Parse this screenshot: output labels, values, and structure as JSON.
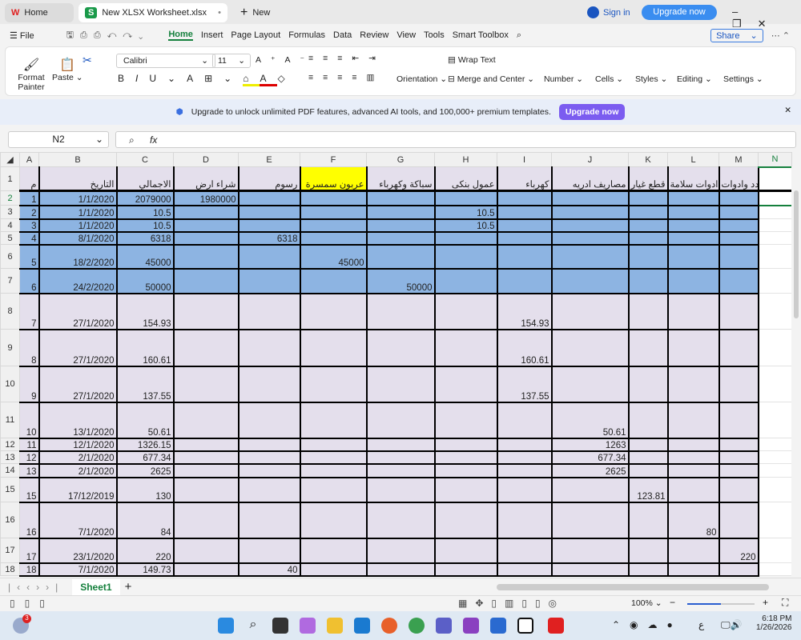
{
  "tabs": {
    "home": "Home",
    "file": "New XLSX Worksheet.xlsx",
    "new": "New"
  },
  "window": {
    "signin": "Sign in",
    "upgrade": "Upgrade now"
  },
  "menu": {
    "file": "File",
    "items": [
      "Home",
      "Insert",
      "Page Layout",
      "Formulas",
      "Data",
      "Review",
      "View",
      "Tools",
      "Smart Toolbox"
    ],
    "share": "Share"
  },
  "ribbon": {
    "format_painter": "Format Painter",
    "paste": "Paste",
    "font": "Calibri",
    "size": "11",
    "wrap": "Wrap Text",
    "merge": "Merge and Center",
    "orientation": "Orientation",
    "number": "Number",
    "cells": "Cells",
    "styles": "Styles",
    "editing": "Editing",
    "settings": "Settings"
  },
  "banner": {
    "text": "Upgrade to unlock unlimited PDF features, advanced AI tools, and 100,000+ premium templates.",
    "button": "Upgrade now"
  },
  "formula": {
    "cell_ref": "N2",
    "fx": "fx",
    "value": ""
  },
  "columns": [
    "A",
    "B",
    "C",
    "D",
    "E",
    "F",
    "G",
    "H",
    "I",
    "J",
    "K",
    "L",
    "M",
    "N"
  ],
  "colors": {
    "blue": "#8db4e2",
    "lavender": "#e4dfec",
    "yellow": "#ffff00"
  },
  "rows": [
    {
      "n": "1",
      "h": 30,
      "fill": "lavender",
      "c": [
        "م",
        "التاريخ",
        "الاجمالي",
        "شراء ارض",
        "رسوم",
        "عربون سمسرة",
        "سباكة وكهرباء",
        "عمول بنكى",
        "كهرباء",
        "مصاريف ادريه",
        "قطع غيار",
        "ادوات سلامة",
        "عدد وادوات",
        ""
      ]
    },
    {
      "n": "2",
      "h": 18,
      "fill": "blue",
      "c": [
        "1",
        "1/1/2020",
        "2079000",
        "1980000",
        "",
        "",
        "",
        "",
        "",
        "",
        "",
        "",
        "",
        ""
      ]
    },
    {
      "n": "3",
      "h": 17,
      "fill": "blue",
      "c": [
        "2",
        "1/1/2020",
        "10.5",
        "",
        "",
        "",
        "",
        "10.5",
        "",
        "",
        "",
        "",
        "",
        ""
      ]
    },
    {
      "n": "4",
      "h": 16,
      "fill": "blue",
      "c": [
        "3",
        "1/1/2020",
        "10.5",
        "",
        "",
        "",
        "",
        "10.5",
        "",
        "",
        "",
        "",
        "",
        ""
      ]
    },
    {
      "n": "5",
      "h": 16,
      "fill": "blue",
      "c": [
        "4",
        "8/1/2020",
        "6318",
        "",
        "6318",
        "",
        "",
        "",
        "",
        "",
        "",
        "",
        "",
        ""
      ]
    },
    {
      "n": "6",
      "h": 30,
      "fill": "blue",
      "c": [
        "5",
        "18/2/2020",
        "45000",
        "",
        "",
        "45000",
        "",
        "",
        "",
        "",
        "",
        "",
        "",
        ""
      ]
    },
    {
      "n": "7",
      "h": 31,
      "fill": "blue",
      "c": [
        "6",
        "24/2/2020",
        "50000",
        "",
        "",
        "",
        "50000",
        "",
        "",
        "",
        "",
        "",
        "",
        ""
      ]
    },
    {
      "n": "8",
      "h": 45,
      "fill": "lavender",
      "c": [
        "7",
        "27/1/2020",
        "154.93",
        "",
        "",
        "",
        "",
        "",
        "154.93",
        "",
        "",
        "",
        "",
        ""
      ]
    },
    {
      "n": "9",
      "h": 46,
      "fill": "lavender",
      "c": [
        "8",
        "27/1/2020",
        "160.61",
        "",
        "",
        "",
        "",
        "",
        "160.61",
        "",
        "",
        "",
        "",
        ""
      ]
    },
    {
      "n": "10",
      "h": 45,
      "fill": "lavender",
      "c": [
        "9",
        "27/1/2020",
        "137.55",
        "",
        "",
        "",
        "",
        "",
        "137.55",
        "",
        "",
        "",
        "",
        ""
      ]
    },
    {
      "n": "11",
      "h": 45,
      "fill": "lavender",
      "c": [
        "10",
        "13/1/2020",
        "50.61",
        "",
        "",
        "",
        "",
        "",
        "",
        "50.61",
        "",
        "",
        "",
        ""
      ]
    },
    {
      "n": "12",
      "h": 16,
      "fill": "lavender",
      "c": [
        "11",
        "12/1/2020",
        "1326.15",
        "",
        "",
        "",
        "",
        "",
        "",
        "1263",
        "",
        "",
        "",
        ""
      ]
    },
    {
      "n": "13",
      "h": 16,
      "fill": "lavender",
      "c": [
        "12",
        "2/1/2020",
        "677.34",
        "",
        "",
        "",
        "",
        "",
        "",
        "677.34",
        "",
        "",
        "",
        ""
      ]
    },
    {
      "n": "14",
      "h": 17,
      "fill": "lavender",
      "c": [
        "13",
        "2/1/2020",
        "2625",
        "",
        "",
        "",
        "",
        "",
        "",
        "2625",
        "",
        "",
        "",
        ""
      ]
    },
    {
      "n": "15",
      "h": 31,
      "fill": "lavender",
      "c": [
        "15",
        "17/12/2019",
        "130",
        "",
        "",
        "",
        "",
        "",
        "",
        "",
        "123.81",
        "",
        "",
        ""
      ]
    },
    {
      "n": "16",
      "h": 45,
      "fill": "lavender",
      "c": [
        "16",
        "7/1/2020",
        "84",
        "",
        "",
        "",
        "",
        "",
        "",
        "",
        "",
        "80",
        "",
        ""
      ]
    },
    {
      "n": "17",
      "h": 31,
      "fill": "lavender",
      "c": [
        "17",
        "23/1/2020",
        "220",
        "",
        "",
        "",
        "",
        "",
        "",
        "",
        "",
        "",
        "220",
        ""
      ]
    },
    {
      "n": "18",
      "h": 16,
      "fill": "lavender",
      "c": [
        "18",
        "7/1/2020",
        "149.73",
        "",
        "40",
        "",
        "",
        "",
        "",
        "",
        "",
        "",
        "",
        ""
      ]
    }
  ],
  "sheet": {
    "tab": "Sheet1",
    "zoom": "100%"
  },
  "taskbar": {
    "time": "6:18 PM",
    "date": "1/26/2026",
    "badge": "3",
    "lang": "ع"
  }
}
